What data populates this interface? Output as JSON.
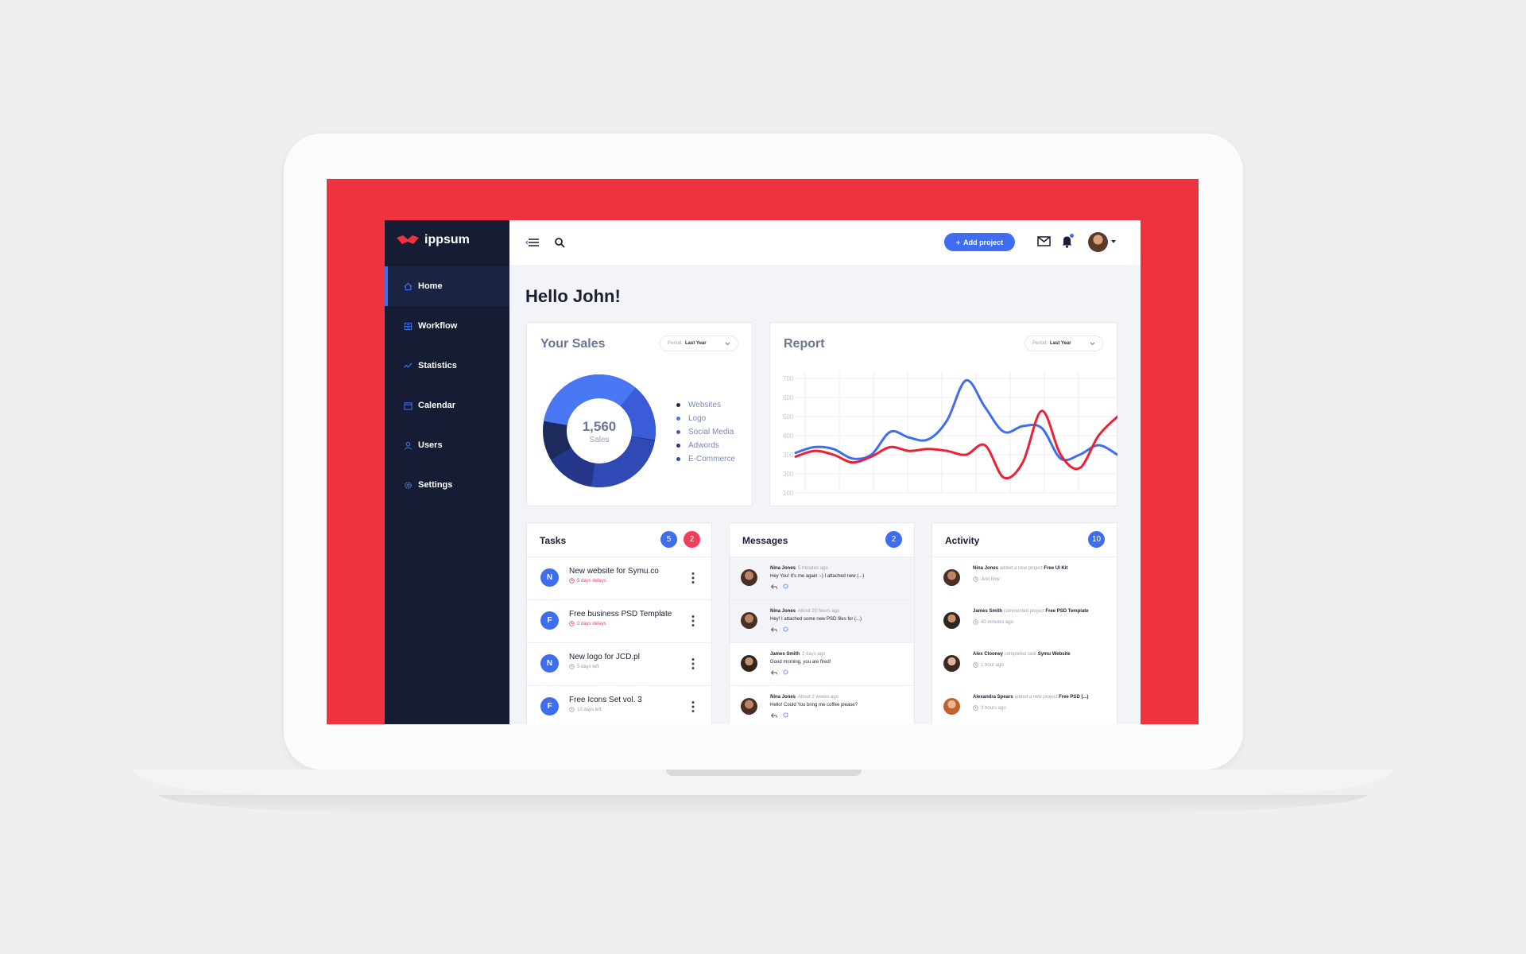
{
  "brand": {
    "name": "ippsum",
    "accent": "#3f6df0",
    "sidebar_bg": "#151c33",
    "frame_red": "#ee333f",
    "alert_red": "#f23d5b"
  },
  "sidebar": {
    "items": [
      {
        "label": "Home",
        "icon": "home-icon",
        "active": true
      },
      {
        "label": "Workflow",
        "icon": "workflow-icon"
      },
      {
        "label": "Statistics",
        "icon": "statistics-icon"
      },
      {
        "label": "Calendar",
        "icon": "calendar-icon"
      },
      {
        "label": "Users",
        "icon": "user-icon"
      },
      {
        "label": "Settings",
        "icon": "gear-icon"
      }
    ]
  },
  "topbar": {
    "add_project_label": "Add project",
    "notification_dot": true
  },
  "greeting": "Hello John!",
  "sales": {
    "title": "Your Sales",
    "period_label": "Period:",
    "period_value": "Last Year",
    "total": "1,560",
    "total_label": "Sales",
    "legend": [
      {
        "label": "Websites",
        "color": "#1d2a5c"
      },
      {
        "label": "Logo",
        "color": "#4a78f5"
      },
      {
        "label": "Social Media",
        "color": "#3a5cd8"
      },
      {
        "label": "Adwords",
        "color": "#24378a"
      },
      {
        "label": "E-Commerce",
        "color": "#2f49b5"
      }
    ]
  },
  "report": {
    "title": "Report",
    "period_label": "Period:",
    "period_value": "Last Year"
  },
  "chart_data": {
    "type": "line",
    "title": "Report",
    "y_ticks": [
      700,
      600,
      500,
      400,
      300,
      200,
      100
    ],
    "ylim": [
      100,
      700
    ],
    "x": [
      0,
      1,
      2,
      3,
      4,
      5,
      6,
      7,
      8,
      9,
      10,
      11,
      12,
      13,
      14,
      15,
      16,
      17
    ],
    "grid": true,
    "series": [
      {
        "color": "#3f6df0",
        "values": [
          310,
          340,
          330,
          280,
          300,
          420,
          390,
          380,
          480,
          690,
          550,
          420,
          450,
          440,
          280,
          300,
          350,
          300
        ]
      },
      {
        "color": "#ee1f35",
        "values": [
          290,
          320,
          300,
          260,
          290,
          340,
          320,
          330,
          320,
          300,
          350,
          180,
          260,
          530,
          300,
          230,
          400,
          500
        ]
      }
    ]
  },
  "tasks": {
    "title": "Tasks",
    "count": "5",
    "alert_count": "2",
    "items": [
      {
        "letter": "N",
        "title": "New website for Symu.co",
        "due": "5 days delays",
        "overdue": true
      },
      {
        "letter": "F",
        "title": "Free business PSD Template",
        "due": "2 days delays",
        "overdue": true
      },
      {
        "letter": "N",
        "title": "New logo for JCD.pl",
        "due": "5 days left",
        "overdue": false
      },
      {
        "letter": "F",
        "title": "Free Icons Set vol. 3",
        "due": "10 days left",
        "overdue": false
      }
    ]
  },
  "messages": {
    "title": "Messages",
    "count": "2",
    "items": [
      {
        "name": "Nina Jones",
        "time": "5 minutes ago",
        "text": "Hey You! It's me again :-) I attached new (...)",
        "unread": true
      },
      {
        "name": "Nina Jones",
        "time": "About 20 hours ago",
        "text": "Hey! I attached some new PSD files for (...)",
        "unread": true
      },
      {
        "name": "James Smith",
        "time": "2 days ago",
        "text": "Good morning, you are fired!",
        "unread": false
      },
      {
        "name": "Nina Jones",
        "time": "About 2 weeks ago",
        "text": "Hello! Could You bring me coffee please?",
        "unread": false
      }
    ]
  },
  "activity": {
    "title": "Activity",
    "count": "10",
    "items": [
      {
        "name": "Nina Jones",
        "action": "added a new project",
        "target": "Free UI Kit",
        "time": "Just now"
      },
      {
        "name": "James Smith",
        "action": "commented project",
        "target": "Free PSD Template",
        "time": "40 minutes ago"
      },
      {
        "name": "Alex Clooney",
        "action": "completed task",
        "target": "Symu Website",
        "time": "1 hour ago"
      },
      {
        "name": "Alexandra Spears",
        "action": "added a new project",
        "target": "Free PSD (...)",
        "time": "3 hours ago"
      }
    ]
  }
}
